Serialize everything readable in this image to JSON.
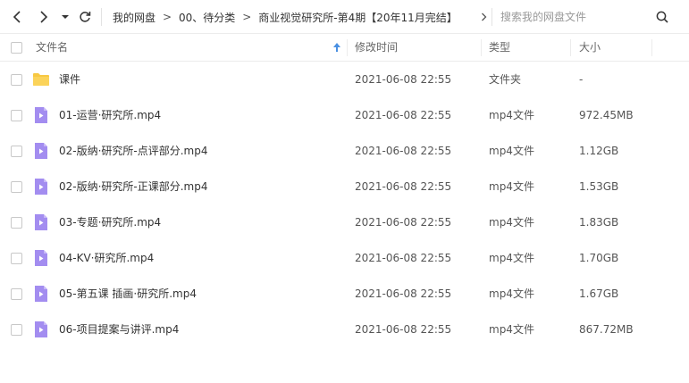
{
  "toolbar": {
    "breadcrumb": [
      "我的网盘",
      "00、待分类",
      "商业视觉研究所-第4期【20年11月完结】"
    ],
    "crumb_separator": ">",
    "search_placeholder": "搜索我的网盘文件"
  },
  "header": {
    "name": "文件名",
    "modified": "修改时间",
    "type": "类型",
    "size": "大小"
  },
  "colors": {
    "folder": "#f7c843",
    "video_icon": "#a38df0",
    "sort_arrow": "#4a90e2"
  },
  "rows": [
    {
      "icon": "folder-icon",
      "name": "课件",
      "date": "2021-06-08 22:55",
      "type": "文件夹",
      "size": "-"
    },
    {
      "icon": "video-file-icon",
      "name": "01-运营·研究所.mp4",
      "date": "2021-06-08 22:55",
      "type": "mp4文件",
      "size": "972.45MB"
    },
    {
      "icon": "video-file-icon",
      "name": "02-版纳·研究所-点评部分.mp4",
      "date": "2021-06-08 22:55",
      "type": "mp4文件",
      "size": "1.12GB"
    },
    {
      "icon": "video-file-icon",
      "name": "02-版纳·研究所-正课部分.mp4",
      "date": "2021-06-08 22:55",
      "type": "mp4文件",
      "size": "1.53GB"
    },
    {
      "icon": "video-file-icon",
      "name": "03-专题·研究所.mp4",
      "date": "2021-06-08 22:55",
      "type": "mp4文件",
      "size": "1.83GB"
    },
    {
      "icon": "video-file-icon",
      "name": "04-KV·研究所.mp4",
      "date": "2021-06-08 22:55",
      "type": "mp4文件",
      "size": "1.70GB"
    },
    {
      "icon": "video-file-icon",
      "name": "05-第五课 插画·研究所.mp4",
      "date": "2021-06-08 22:55",
      "type": "mp4文件",
      "size": "1.67GB"
    },
    {
      "icon": "video-file-icon",
      "name": "06-项目提案与讲评.mp4",
      "date": "2021-06-08 22:55",
      "type": "mp4文件",
      "size": "867.72MB"
    }
  ]
}
